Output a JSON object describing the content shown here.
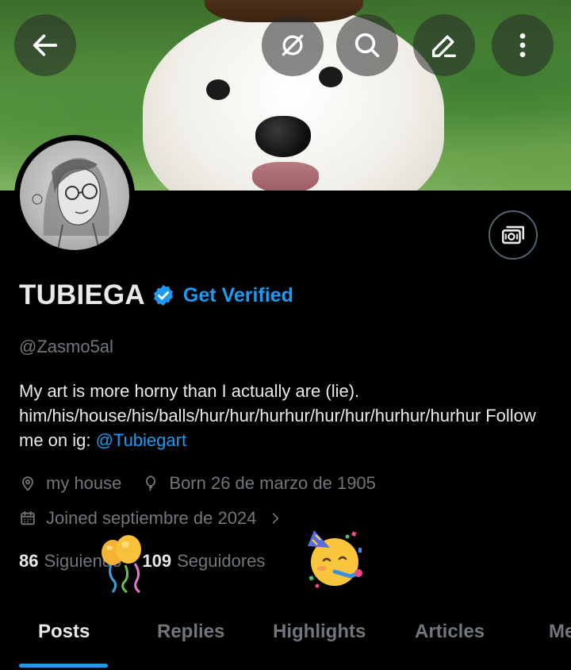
{
  "header": {
    "back_icon": "arrow-left-icon",
    "grok_icon": "grok-icon",
    "search_icon": "search-icon",
    "edit_icon": "pencil-icon",
    "more_icon": "more-vertical-icon"
  },
  "profile": {
    "display_name": "TUBIEGA",
    "verified": true,
    "get_verified_label": "Get Verified",
    "handle": "@Zasmo5al",
    "bio_text": "My art is more horny than I actually are (lie). him/his/house/his/balls/hur/hur/hurhur/hur/hur/hurhur/hurhur Follow me on ig: ",
    "bio_link": "@Tubiegart",
    "location": "my house",
    "birthday": "Born 26 de marzo de 1905",
    "joined": "Joined septiembre de 2024",
    "following_count": "86",
    "following_label": "Siguiendo",
    "followers_count": "109",
    "followers_label": "Seguidores"
  },
  "tabs": [
    {
      "label": "Posts",
      "active": true
    },
    {
      "label": "Replies",
      "active": false
    },
    {
      "label": "Highlights",
      "active": false
    },
    {
      "label": "Articles",
      "active": false
    },
    {
      "label": "Me",
      "active": false
    }
  ],
  "colors": {
    "accent": "#1d9bf0",
    "background": "#000000",
    "secondary_text": "#71767b"
  }
}
